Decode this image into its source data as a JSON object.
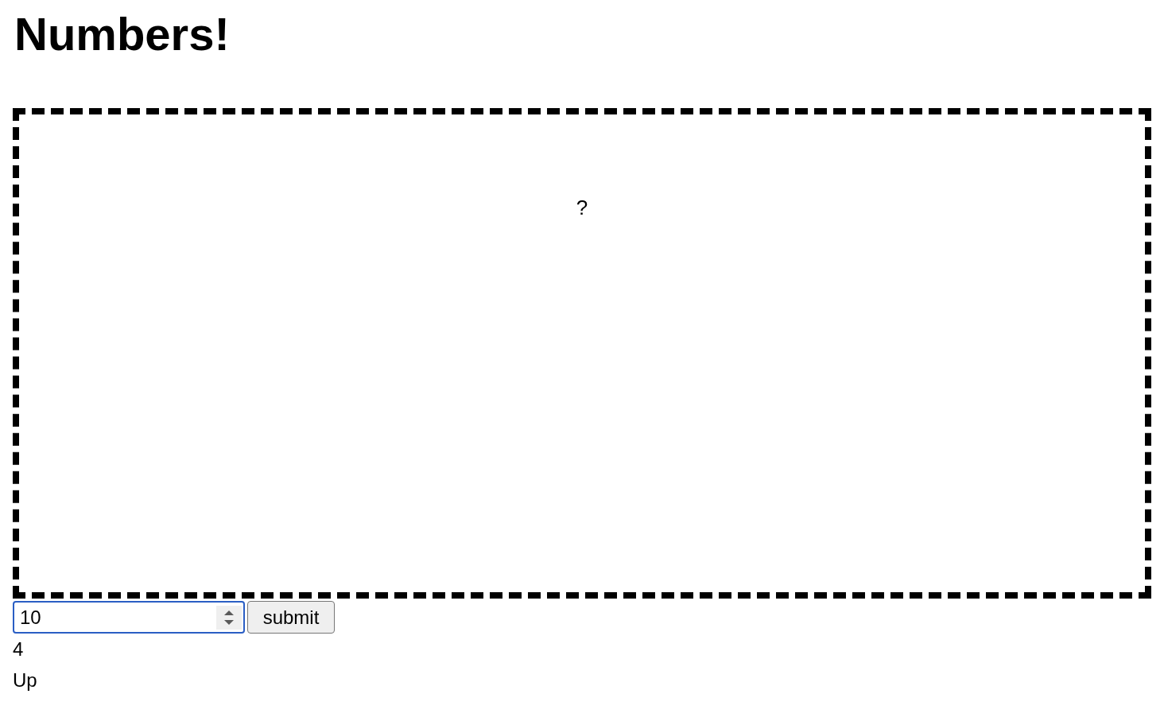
{
  "title": "Numbers!",
  "game_board": {
    "hidden_number": "?"
  },
  "guess_form": {
    "input": {
      "value": "10",
      "focused": true
    },
    "submit_button": "submit"
  },
  "results": [
    "4",
    "Up"
  ]
}
